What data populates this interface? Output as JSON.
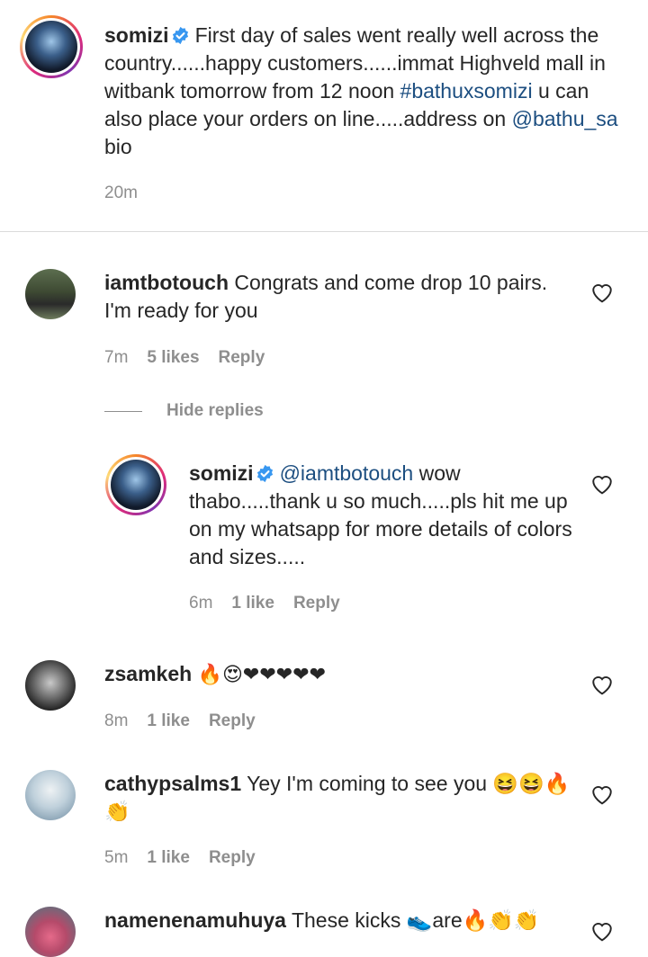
{
  "caption": {
    "username": "somizi",
    "text_part1": "First day of sales went really well across the country......happy customers......immat Highveld mall in witbank tomorrow from 12 noon ",
    "hashtag": "#bathuxsomizi",
    "text_part2": " u can also place your orders on line.....address on ",
    "mention": "@bathu_sa",
    "text_part3": " bio",
    "time": "20m"
  },
  "comments": [
    {
      "username": "iamtbotouch",
      "text": "Congrats and come drop 10 pairs. I'm ready for you",
      "time": "7m",
      "likes": "5 likes",
      "reply": "Reply",
      "hide_replies": "Hide replies",
      "reply_item": {
        "username": "somizi",
        "mention": "@iamtbotouch",
        "text": " wow thabo.....thank u so much.....pls hit me up on my whatsapp for more details of colors and sizes.....",
        "time": "6m",
        "likes": "1 like",
        "reply": "Reply"
      }
    },
    {
      "username": "zsamkeh",
      "text": "🔥😍❤❤❤❤❤",
      "time": "8m",
      "likes": "1 like",
      "reply": "Reply"
    },
    {
      "username": "cathypsalms1",
      "text": "Yey I'm coming to see you 😆😆🔥👏",
      "time": "5m",
      "likes": "1 like",
      "reply": "Reply"
    },
    {
      "username": "namenenamuhuya",
      "text": "These kicks 👟are🔥👏👏",
      "time": "",
      "likes": "",
      "reply": ""
    }
  ],
  "colors": {
    "link": "#1c4e80",
    "meta": "#8e8e8e",
    "verified": "#3897f0"
  }
}
